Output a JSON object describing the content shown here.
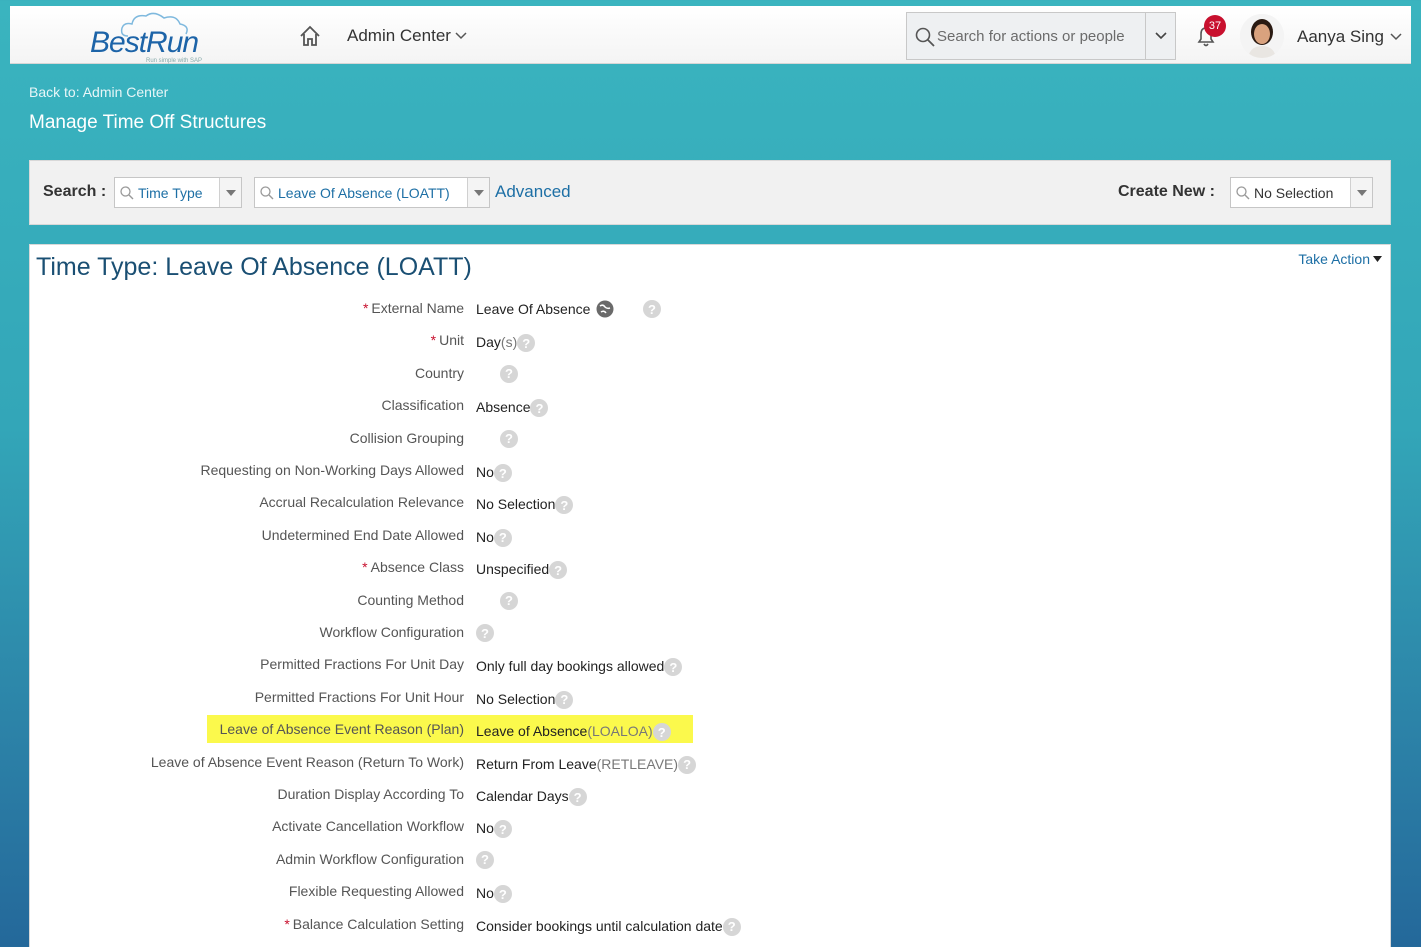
{
  "header": {
    "logo_text": "BestRun",
    "logo_tagline": "Run simple with SAP",
    "admin_menu_label": "Admin Center",
    "search_placeholder": "Search for actions or people",
    "notification_count": "37",
    "user_name": "Aanya Sing"
  },
  "nav": {
    "back_link": "Back to: Admin Center",
    "page_title": "Manage Time Off Structures"
  },
  "search_panel": {
    "label": "Search :",
    "object_type": "Time Type",
    "object_value": "Leave Of Absence (LOATT)",
    "advanced_label": "Advanced",
    "create_new_label": "Create New :",
    "create_new_value": "No Selection"
  },
  "detail": {
    "title": "Time Type: Leave Of Absence (LOATT)",
    "take_action_label": "Take Action",
    "fields": [
      {
        "label": "External Name",
        "required": true,
        "value": "Leave Of Absence",
        "code": ""
      },
      {
        "label": "Unit",
        "required": true,
        "value": "Day",
        "code": "(s)"
      },
      {
        "label": "Country",
        "required": false,
        "value": "",
        "code": ""
      },
      {
        "label": "Classification",
        "required": false,
        "value": "Absence",
        "code": ""
      },
      {
        "label": "Collision Grouping",
        "required": false,
        "value": "",
        "code": ""
      },
      {
        "label": "Requesting on Non-Working Days Allowed",
        "required": false,
        "value": "No",
        "code": ""
      },
      {
        "label": "Accrual Recalculation Relevance",
        "required": false,
        "value": "No Selection",
        "code": ""
      },
      {
        "label": "Undetermined End Date Allowed",
        "required": false,
        "value": "No",
        "code": ""
      },
      {
        "label": "Absence Class",
        "required": true,
        "value": "Unspecified",
        "code": ""
      },
      {
        "label": "Counting Method",
        "required": false,
        "value": "",
        "code": ""
      },
      {
        "label": "Workflow Configuration",
        "required": false,
        "value": "",
        "code": ""
      },
      {
        "label": "Permitted Fractions For Unit Day",
        "required": false,
        "value": "Only full day bookings allowed",
        "code": ""
      },
      {
        "label": "Permitted Fractions For Unit Hour",
        "required": false,
        "value": "No Selection",
        "code": ""
      },
      {
        "label": "Leave of Absence Event Reason (Plan)",
        "required": false,
        "value": "Leave of Absence",
        "code": " (LOALOA)"
      },
      {
        "label": "Leave of Absence Event Reason (Return To Work)",
        "required": false,
        "value": "Return From Leave",
        "code": " (RETLEAVE)"
      },
      {
        "label": "Duration Display According To",
        "required": false,
        "value": "Calendar Days",
        "code": ""
      },
      {
        "label": "Activate Cancellation Workflow",
        "required": false,
        "value": "No",
        "code": ""
      },
      {
        "label": "Admin Workflow Configuration",
        "required": false,
        "value": "",
        "code": ""
      },
      {
        "label": "Flexible Requesting Allowed",
        "required": false,
        "value": "No",
        "code": ""
      },
      {
        "label": "Balance Calculation Setting",
        "required": true,
        "value": "Consider bookings until calculation date",
        "code": ""
      }
    ]
  },
  "colors": {
    "accent_link": "#1d6fa5",
    "title": "#1a4f73",
    "required": "#c8102e",
    "highlight": "#fbf94c",
    "badge": "#c8102e"
  }
}
